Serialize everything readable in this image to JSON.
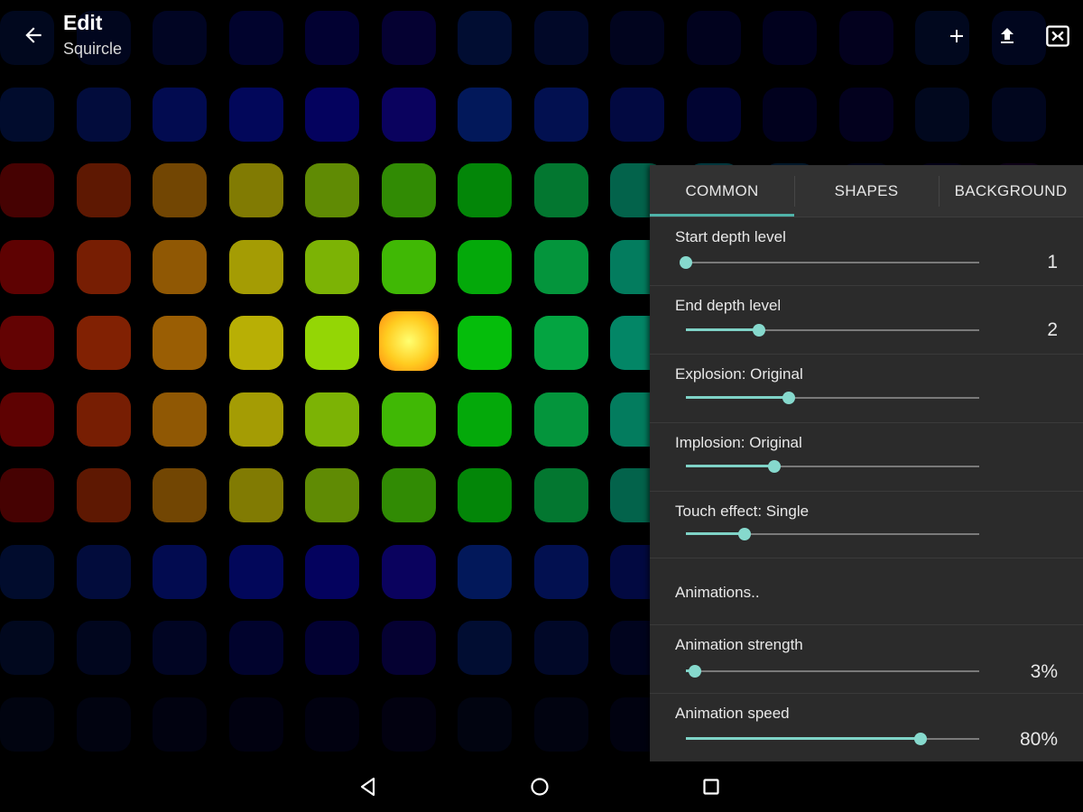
{
  "app_bar": {
    "title": "Edit",
    "subtitle": "Squircle",
    "icons": [
      "back-arrow-icon",
      "add-icon",
      "upload-icon",
      "fullscreen-exit-icon"
    ]
  },
  "panel": {
    "tabs": [
      {
        "label": "COMMON",
        "selected": true
      },
      {
        "label": "SHAPES",
        "selected": false
      },
      {
        "label": "BACKGROUND",
        "selected": false
      }
    ],
    "settings": [
      {
        "label": "Start depth level",
        "value": "1",
        "level": 0.0
      },
      {
        "label": "End depth level",
        "value": "2",
        "level": 0.25
      },
      {
        "label": "Explosion: Original",
        "value": "",
        "level": 0.35
      },
      {
        "label": "Implosion: Original",
        "value": "",
        "level": 0.3
      },
      {
        "label": "Touch effect: Single",
        "value": "",
        "level": 0.2
      },
      {
        "label": "Animations..",
        "value": "",
        "level": null
      },
      {
        "label": "Animation strength",
        "value": "3%",
        "level": 0.03
      },
      {
        "label": "Animation speed",
        "value": "80%",
        "level": 0.8
      }
    ]
  },
  "nav_bar": {
    "icons": [
      "back-triangle-icon",
      "home-circle-icon",
      "recents-square-icon"
    ]
  },
  "colors": {
    "accent": "#7fd3c7",
    "panel_bg": "#2b2b2b",
    "tab_bg": "#323232"
  }
}
